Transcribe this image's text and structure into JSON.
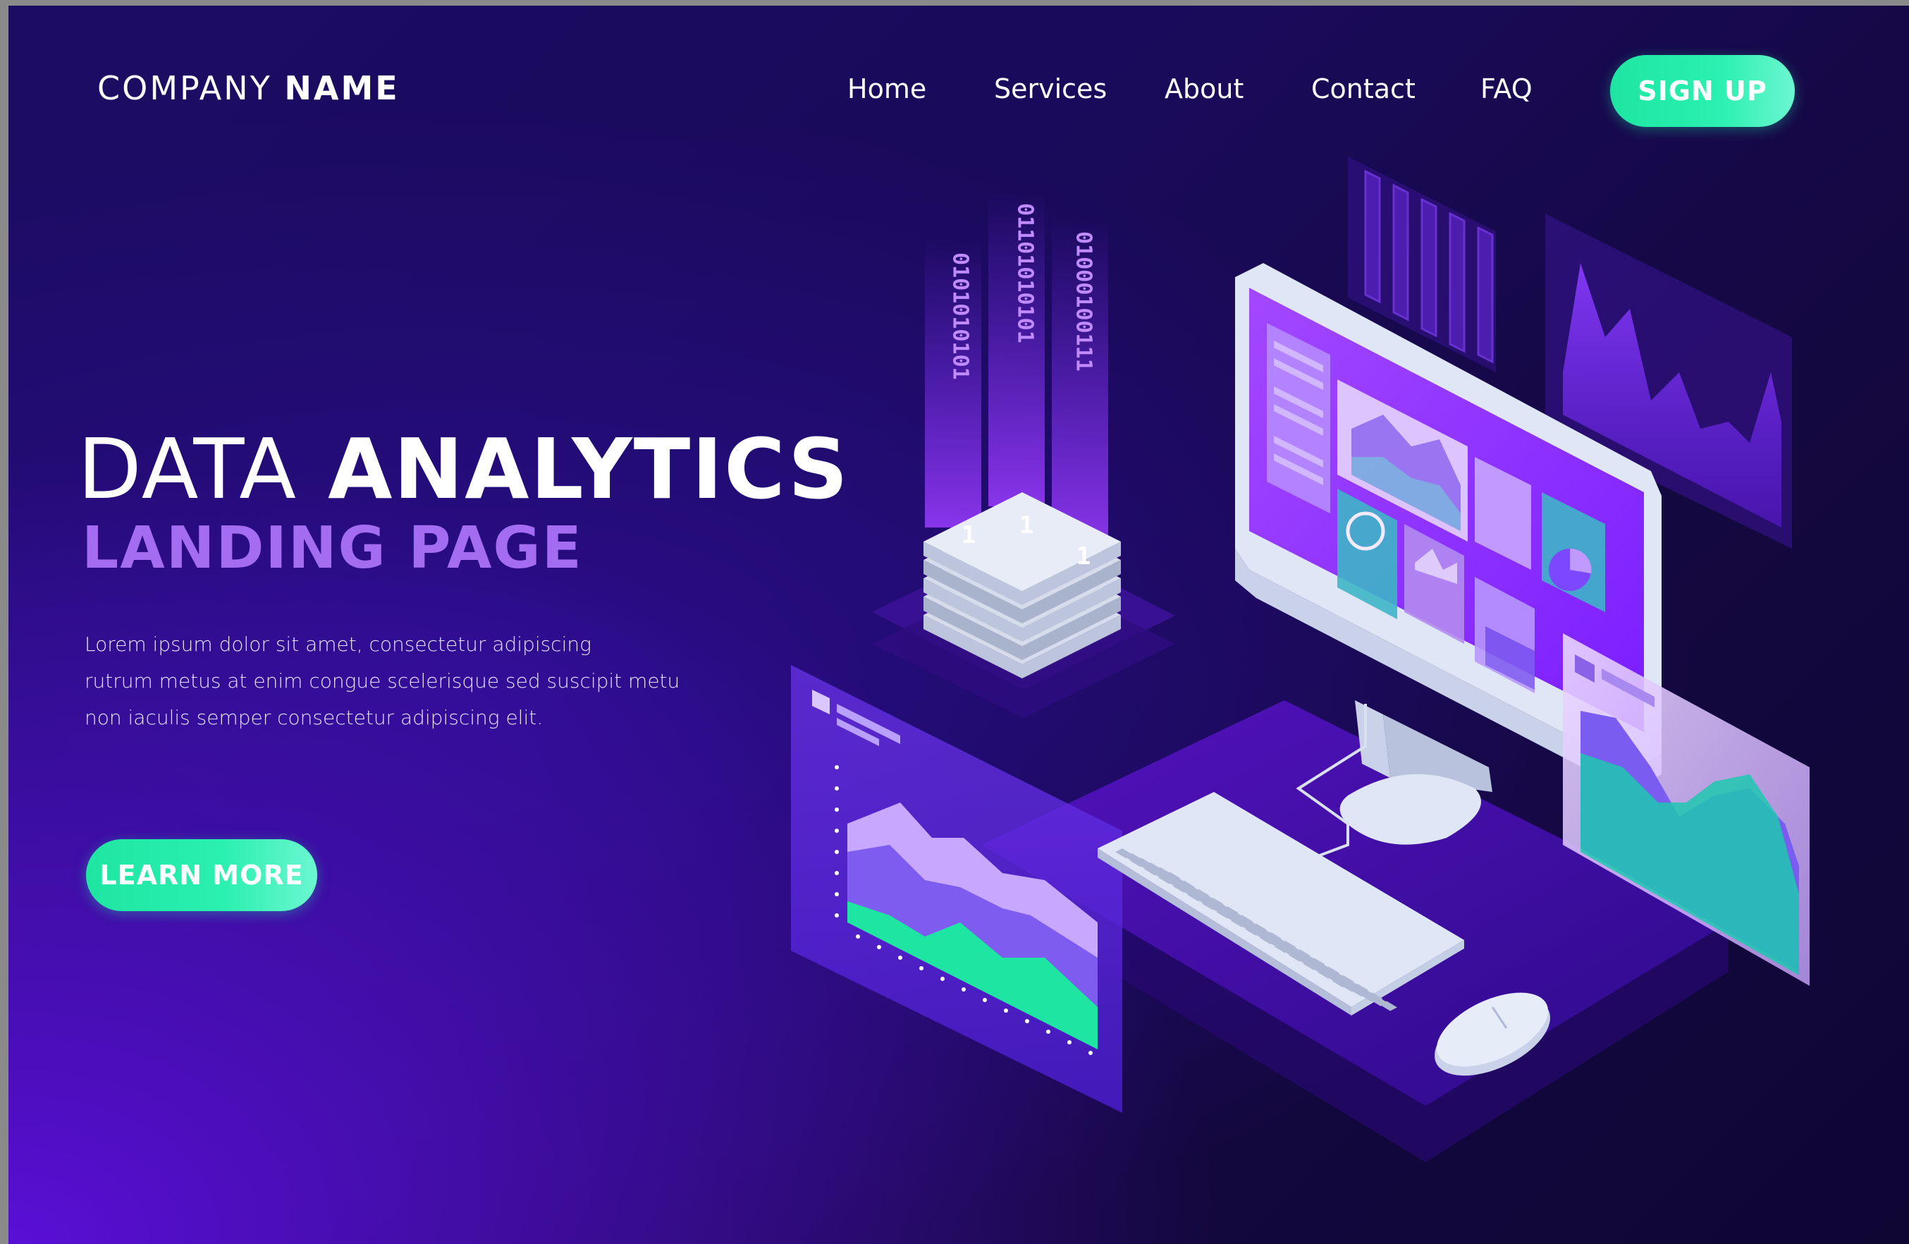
{
  "brand": {
    "name_light": "COMPANY",
    "name_bold": "NAME"
  },
  "nav": {
    "items": [
      {
        "label": "Home"
      },
      {
        "label": "Services"
      },
      {
        "label": "About"
      },
      {
        "label": "Contact"
      },
      {
        "label": "FAQ"
      }
    ],
    "signup_label": "SIGN UP"
  },
  "hero": {
    "title_light": "DATA",
    "title_bold": "ANALYTICS",
    "subtitle": "LANDING PAGE",
    "body_lines": [
      "Lorem ipsum dolor sit amet, consectetur adipiscing",
      "rutrum metus at enim congue scelerisque sed suscipit metu",
      "non iaculis semper consectetur adipiscing elit."
    ],
    "cta_label": "LEARN MORE"
  },
  "illustration": {
    "binary_streams": [
      "0101010101",
      "01101010101",
      "01000100111"
    ],
    "binary_caps": [
      "1",
      "1",
      "1"
    ],
    "colors": {
      "accent_green": "#1ee6a2",
      "accent_purple": "#a46cf0",
      "screen_violet": "#9a3cff",
      "device_white": "#dfe6f5"
    }
  }
}
